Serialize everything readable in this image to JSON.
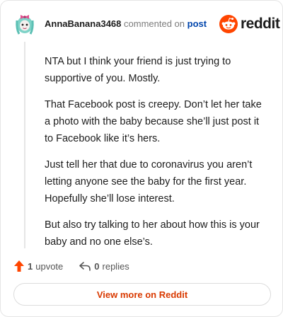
{
  "comment": {
    "author": "AnnaBanana3468",
    "verb": "commented on",
    "target": "post",
    "paragraphs": [
      "NTA but I think your friend is just trying to supportive of you. Mostly.",
      "That Facebook post is creepy. Don’t let her take a photo with the baby because she’ll just post it to Facebook like it’s hers.",
      "Just tell her that due to coronavirus you aren’t letting anyone see the baby for the first year. Hopefully she’ll lose interest.",
      "But also try talking to her about how this is your baby and no one else’s."
    ]
  },
  "brand": {
    "wordmark": "reddit",
    "icon": "reddit-snoo-icon",
    "color": "#ff4500"
  },
  "actions": {
    "upvote_count": "1",
    "upvote_label": "upvote",
    "reply_count": "0",
    "reply_label": "replies"
  },
  "footer": {
    "view_more_label": "View more on Reddit"
  },
  "colors": {
    "accent": "#d93900",
    "link": "#0045ac",
    "upvote": "#ff4500"
  }
}
